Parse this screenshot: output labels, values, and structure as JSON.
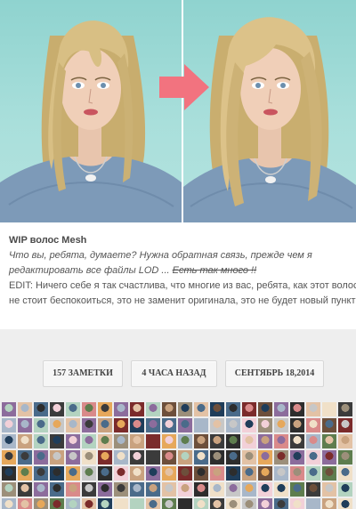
{
  "post": {
    "title": "WIP волос Mesh",
    "italic_line_1": "Что вы, ребята, думаете? Нужна обратная связь, прежде чем я",
    "italic_line_2_prefix": "редактировать все файлы LOD ... ",
    "italic_line_2_strike": "Есть так много !!",
    "edit_line_1": "EDIT: Ничего себе я так счастлива, что многие из вас, ребята, как этот волос! И",
    "edit_line_2": "не стоит беспокоиться, это не заменит оригинала, это не будет новый пункт (:"
  },
  "meta": {
    "notes": "157 ЗАМЕТКИ",
    "time": "4 ЧАСА НАЗАД",
    "date": "СЕНТЯБРЬ 18,2014"
  },
  "colors": {
    "background": "#eeeeee",
    "card": "#ffffff",
    "panel_teal": "#a9dfdb",
    "arrow": "#f2737f"
  },
  "icons": {
    "arrow": "arrow-right-icon"
  }
}
